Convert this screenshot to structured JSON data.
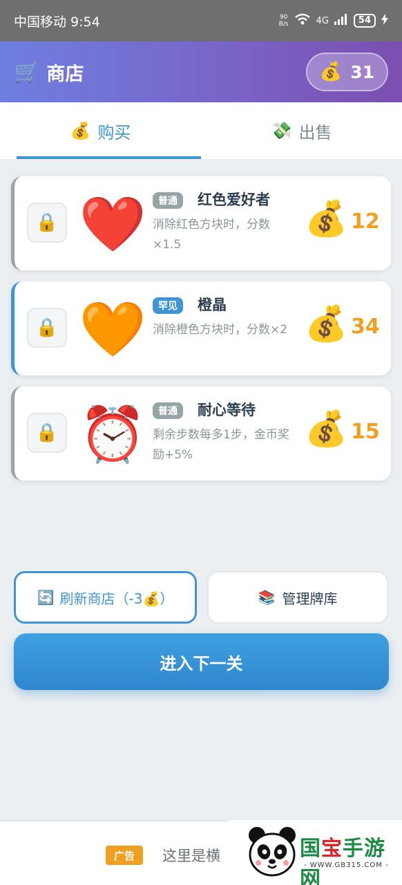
{
  "status_bar": {
    "carrier_time": "中国移动 9:54",
    "speed_value": "90",
    "speed_unit": "B/s",
    "network": "4G",
    "battery": "54"
  },
  "header": {
    "title": "商店",
    "cart_icon": "🛒",
    "coins": "31",
    "coin_icon": "💰"
  },
  "tabs": [
    {
      "label": "购买",
      "icon": "💰",
      "active": true
    },
    {
      "label": "出售",
      "icon": "💸",
      "active": false
    }
  ],
  "items": [
    {
      "emoji": "❤️",
      "tier": "普通",
      "name": "红色爱好者",
      "desc": "消除红色方块时，分数×1.5",
      "price": "12",
      "lock_icon": "🔒",
      "price_icon": "💰"
    },
    {
      "emoji": "🧡",
      "tier": "罕见",
      "name": "橙晶",
      "desc": "消除橙色方块时，分数×2",
      "price": "34",
      "lock_icon": "🔒",
      "price_icon": "💰"
    },
    {
      "emoji": "⏰",
      "tier": "普通",
      "name": "耐心等待",
      "desc": "剩余步数每多1步，金币奖励+5%",
      "price": "15",
      "lock_icon": "🔒",
      "price_icon": "💰"
    }
  ],
  "buttons": {
    "refresh_icon": "🔄",
    "refresh_label": "刷新商店（-3💰）",
    "manage_icon": "📚",
    "manage_label": "管理牌库",
    "next_label": "进入下一关"
  },
  "ad": {
    "tag": "广告",
    "text": "这里是横"
  },
  "watermark": {
    "brand_green": "国",
    "brand_red": "宝",
    "brand_rest": "手游网",
    "url": "- WWW.GB315.COM -"
  },
  "colors": {
    "accent": "#3f95d4",
    "price": "#f0a020",
    "header_start": "#6e7fe0",
    "header_end": "#7a4fb0"
  }
}
